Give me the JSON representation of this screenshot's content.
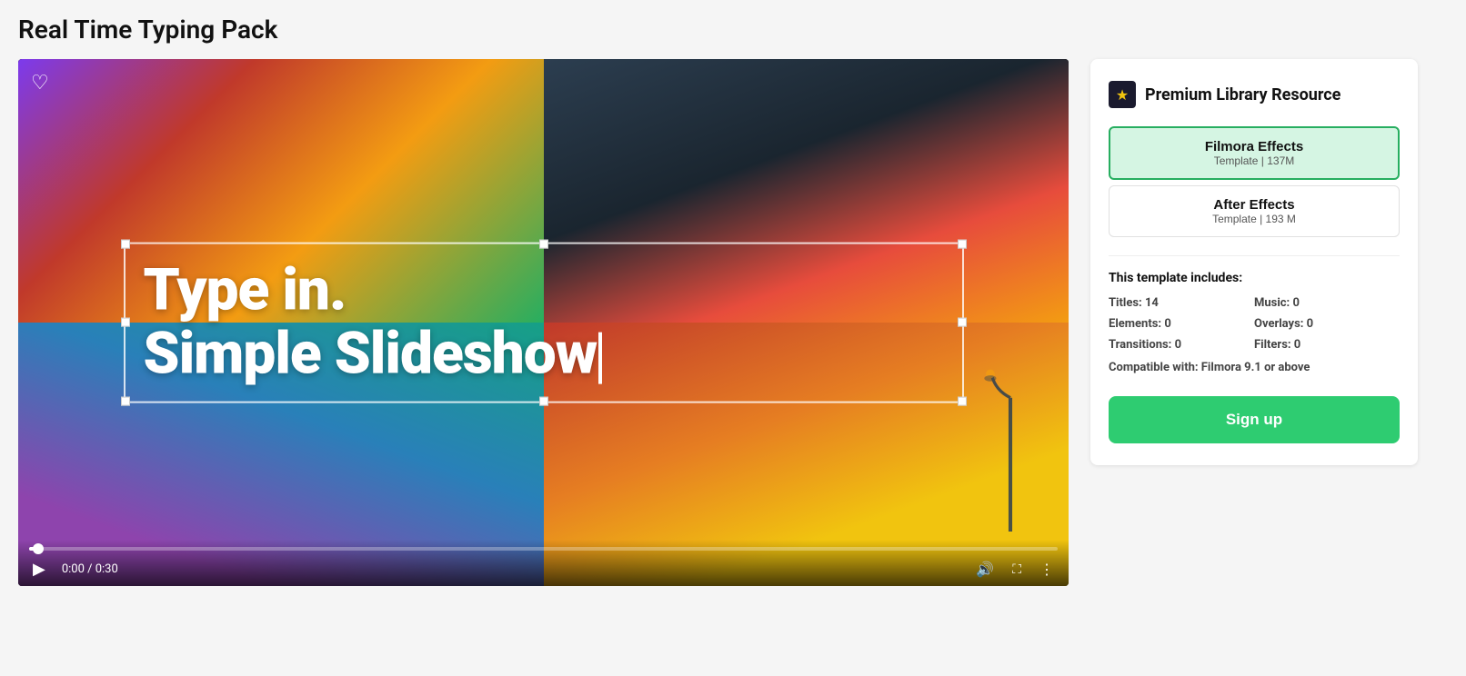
{
  "page": {
    "title": "Real Time Typing Pack"
  },
  "video": {
    "heart_label": "♡",
    "main_text_line1": "Type in.",
    "main_text_line2": "Simple Slideshow",
    "time_current": "0:00",
    "time_total": "0:30",
    "time_display": "0:00 / 0:30"
  },
  "sidebar": {
    "premium_label": "Premium Library Resource",
    "premium_icon": "★",
    "filmora_btn_title": "Filmora Effects",
    "filmora_btn_sub": "Template | 137M",
    "ae_btn_title": "After Effects",
    "ae_btn_sub": "Template | 193 M",
    "includes_title": "This template includes:",
    "titles_label": "Titles:",
    "titles_value": "14",
    "music_label": "Music:",
    "music_value": "0",
    "elements_label": "Elements:",
    "elements_value": "0",
    "overlays_label": "Overlays:",
    "overlays_value": "0",
    "transitions_label": "Transitions:",
    "transitions_value": "0",
    "filters_label": "Filters:",
    "filters_value": "0",
    "compatible_label": "Compatible with:",
    "compatible_value": "Filmora 9.1 or above",
    "signup_label": "Sign up"
  },
  "controls": {
    "play_icon": "▶",
    "volume_icon": "🔊",
    "fullscreen_icon": "⛶",
    "more_icon": "⋮"
  }
}
